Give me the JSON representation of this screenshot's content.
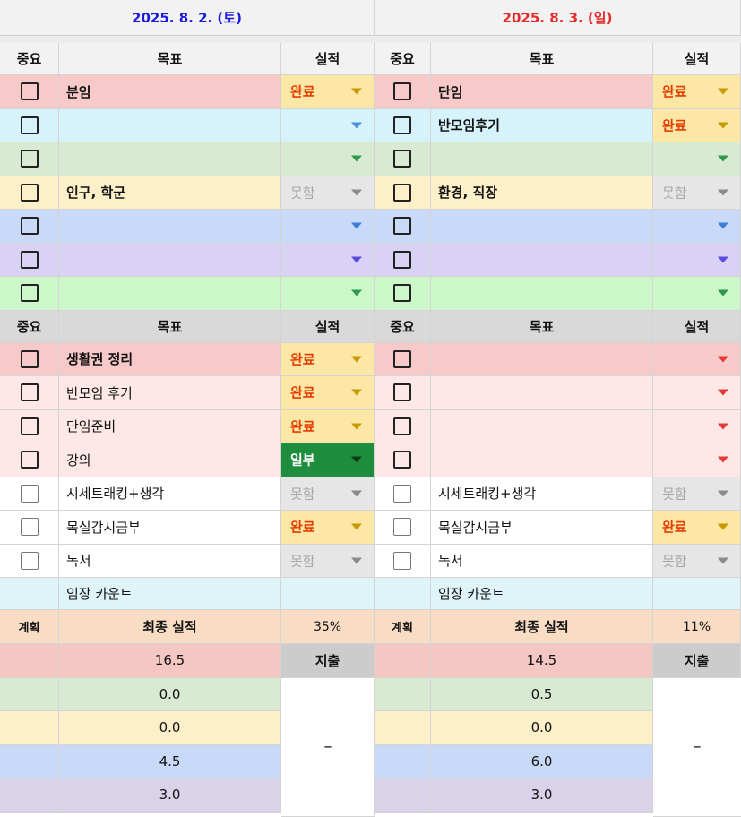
{
  "colors": {
    "header_bg": "#f2f2f2",
    "section_header_bg": "#d9d9d9",
    "plan_header_bg": "#f9dcc4",
    "red_row": "#f8c9c9",
    "cyan_row": "#d6f3fb",
    "green_row": "#d9ead3",
    "yellow_row": "#fdefc8",
    "blue_row": "#c9daf8",
    "purple_row": "#d9d2f4",
    "lightgreen_row": "#ccf7c8",
    "pink_row": "#fde7e7",
    "count_row": "#def4f9",
    "total_red": "#f4c7c3",
    "total_green": "#d9ead3",
    "total_yellow": "#fdefc8",
    "total_blue": "#c9daf8",
    "total_purple": "#d9d2e9",
    "done_bg": "#fde7a6",
    "done_text": "#e63c00",
    "partial_bg": "#1e8e3e",
    "fail_bg": "#e6e6e6",
    "fail_text": "#a6a6a6",
    "submit_bg": "#cccccc"
  },
  "days": [
    {
      "date": "2025. 8. 2. (토)",
      "date_color": "#1a1adb",
      "top_headers": {
        "importance": "중요",
        "goal": "목표",
        "result": "실적"
      },
      "top_rows": [
        {
          "goal": "분임",
          "status": "완료",
          "color": "red"
        },
        {
          "goal": "",
          "status": "",
          "color": "cyan"
        },
        {
          "goal": "",
          "status": "",
          "color": "green"
        },
        {
          "goal": "인구, 학군",
          "status": "못함",
          "color": "yellow"
        },
        {
          "goal": "",
          "status": "",
          "color": "blue"
        },
        {
          "goal": "",
          "status": "",
          "color": "purple"
        },
        {
          "goal": "",
          "status": "",
          "color": "lightgreen"
        }
      ],
      "bottom_headers": {
        "importance": "중요",
        "goal": "목표",
        "result": "실적"
      },
      "bottom_rows": [
        {
          "goal": "생활권 정리",
          "status": "완료",
          "color": "red"
        },
        {
          "goal": "반모임 후기",
          "status": "완료",
          "color": "pink"
        },
        {
          "goal": "단임준비",
          "status": "완료",
          "color": "pink"
        },
        {
          "goal": "강의",
          "status": "일부",
          "color": "pink"
        },
        {
          "goal": "시세트래킹+생각",
          "status": "못함",
          "color": "white"
        },
        {
          "goal": "목실감시금부",
          "status": "완료",
          "color": "white"
        },
        {
          "goal": "독서",
          "status": "못함",
          "color": "white"
        }
      ],
      "count_label": "임장 카운트",
      "plan_label": "계획",
      "final_label": "최종 실적",
      "final_percent": "35%",
      "submit_label": "지출",
      "submit_value": "–",
      "totals": [
        "16.5",
        "0.0",
        "0.0",
        "4.5",
        "3.0"
      ]
    },
    {
      "date": "2025. 8. 3. (일)",
      "date_color": "#e52b2b",
      "top_headers": {
        "importance": "중요",
        "goal": "목표",
        "result": "실적"
      },
      "top_rows": [
        {
          "goal": "단임",
          "status": "완료",
          "color": "red"
        },
        {
          "goal": "반모임후기",
          "status": "완료",
          "color": "cyan"
        },
        {
          "goal": "",
          "status": "",
          "color": "green"
        },
        {
          "goal": "환경, 직장",
          "status": "못함",
          "color": "yellow"
        },
        {
          "goal": "",
          "status": "",
          "color": "blue"
        },
        {
          "goal": "",
          "status": "",
          "color": "purple"
        },
        {
          "goal": "",
          "status": "",
          "color": "lightgreen"
        }
      ],
      "bottom_headers": {
        "importance": "중요",
        "goal": "목표",
        "result": "실적"
      },
      "bottom_rows": [
        {
          "goal": "",
          "status": "",
          "color": "red"
        },
        {
          "goal": "",
          "status": "",
          "color": "pink"
        },
        {
          "goal": "",
          "status": "",
          "color": "pink"
        },
        {
          "goal": "",
          "status": "",
          "color": "pink"
        },
        {
          "goal": "시세트래킹+생각",
          "status": "못함",
          "color": "white"
        },
        {
          "goal": "목실감시금부",
          "status": "완료",
          "color": "white"
        },
        {
          "goal": "독서",
          "status": "못함",
          "color": "white"
        }
      ],
      "count_label": "임장 카운트",
      "plan_label": "계획",
      "final_label": "최종 실적",
      "final_percent": "11%",
      "submit_label": "지출",
      "submit_value": "–",
      "totals": [
        "14.5",
        "0.5",
        "0.0",
        "6.0",
        "3.0"
      ]
    }
  ]
}
